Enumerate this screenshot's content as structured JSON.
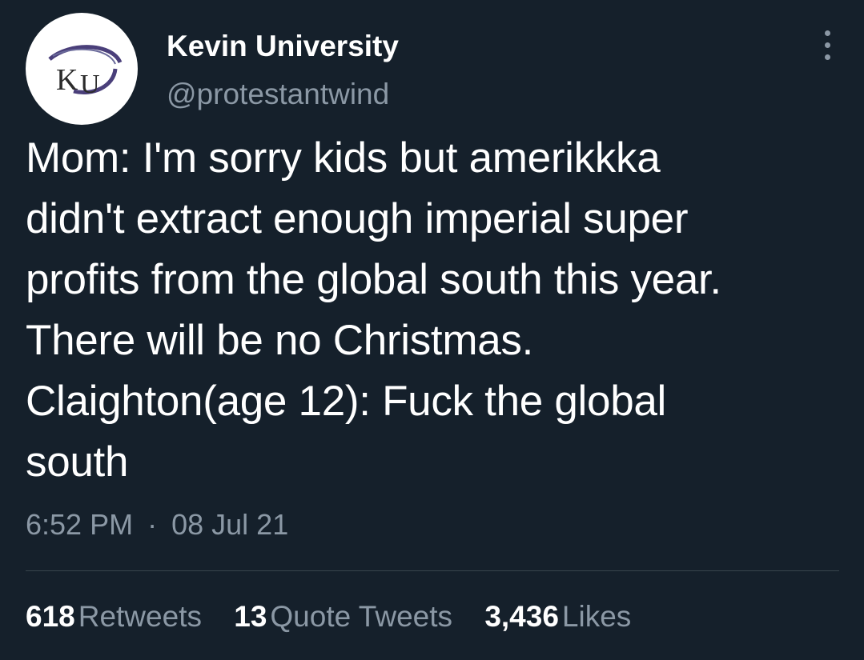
{
  "author": {
    "display_name": "Kevin University",
    "handle": "@protestantwind",
    "avatar_text": "KU",
    "avatar_colors": {
      "background": "#ffffff",
      "swoosh": "#4a3f7a",
      "letters": "#2b2b2b"
    }
  },
  "header": {
    "more_icon": "more-vertical-icon"
  },
  "tweet": {
    "text": "Mom: I'm sorry kids but amerikkka\ndidn't extract enough imperial super\nprofits from the global south this year.\nThere will be no Christmas.\nClaighton(age 12): Fuck the global\nsouth"
  },
  "meta": {
    "time": "6:52 PM",
    "separator": "·",
    "date": "08 Jul 21"
  },
  "stats": {
    "retweets": {
      "count": "618",
      "label": "Retweets"
    },
    "quote_tweets": {
      "count": "13",
      "label": "Quote Tweets"
    },
    "likes": {
      "count": "3,436",
      "label": "Likes"
    }
  },
  "colors": {
    "background": "#15202b",
    "primary_text": "#ffffff",
    "secondary_text": "#8b98a5",
    "divider": "#38444d"
  }
}
